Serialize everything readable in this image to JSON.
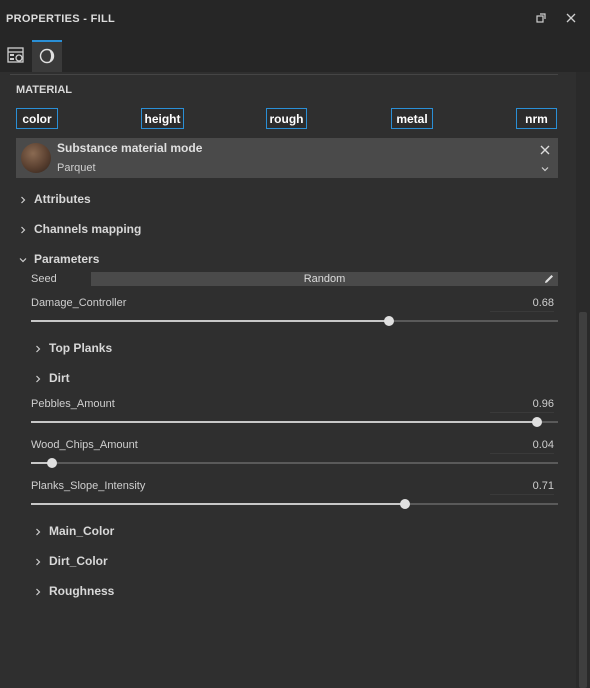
{
  "window": {
    "title": "PROPERTIES - FILL"
  },
  "tabs": [
    {
      "icon": "texture-set-settings-icon",
      "active": false
    },
    {
      "icon": "material-sphere-icon",
      "active": true
    }
  ],
  "material_section": {
    "label": "MATERIAL",
    "channels": [
      "color",
      "height",
      "rough",
      "metal",
      "nrm"
    ]
  },
  "substance": {
    "mode_title": "Substance material mode",
    "preset": "Parquet"
  },
  "groups": {
    "attributes": "Attributes",
    "channels_mapping": "Channels mapping",
    "parameters": "Parameters"
  },
  "parameters": {
    "seed": {
      "label": "Seed",
      "button": "Random"
    },
    "damage_controller": {
      "label": "Damage_Controller",
      "value": "0.68",
      "fraction": 0.68
    },
    "top_planks": "Top Planks",
    "dirt": "Dirt",
    "pebbles_amount": {
      "label": "Pebbles_Amount",
      "value": "0.96",
      "fraction": 0.96
    },
    "wood_chips_amount": {
      "label": "Wood_Chips_Amount",
      "value": "0.04",
      "fraction": 0.04
    },
    "planks_slope_intensity": {
      "label": "Planks_Slope_Intensity",
      "value": "0.71",
      "fraction": 0.71
    },
    "main_color": "Main_Color",
    "dirt_color": "Dirt_Color",
    "roughness": "Roughness"
  },
  "colors": {
    "accent": "#2a8fd6",
    "panel": "#2f2f2f",
    "header": "#262626"
  }
}
